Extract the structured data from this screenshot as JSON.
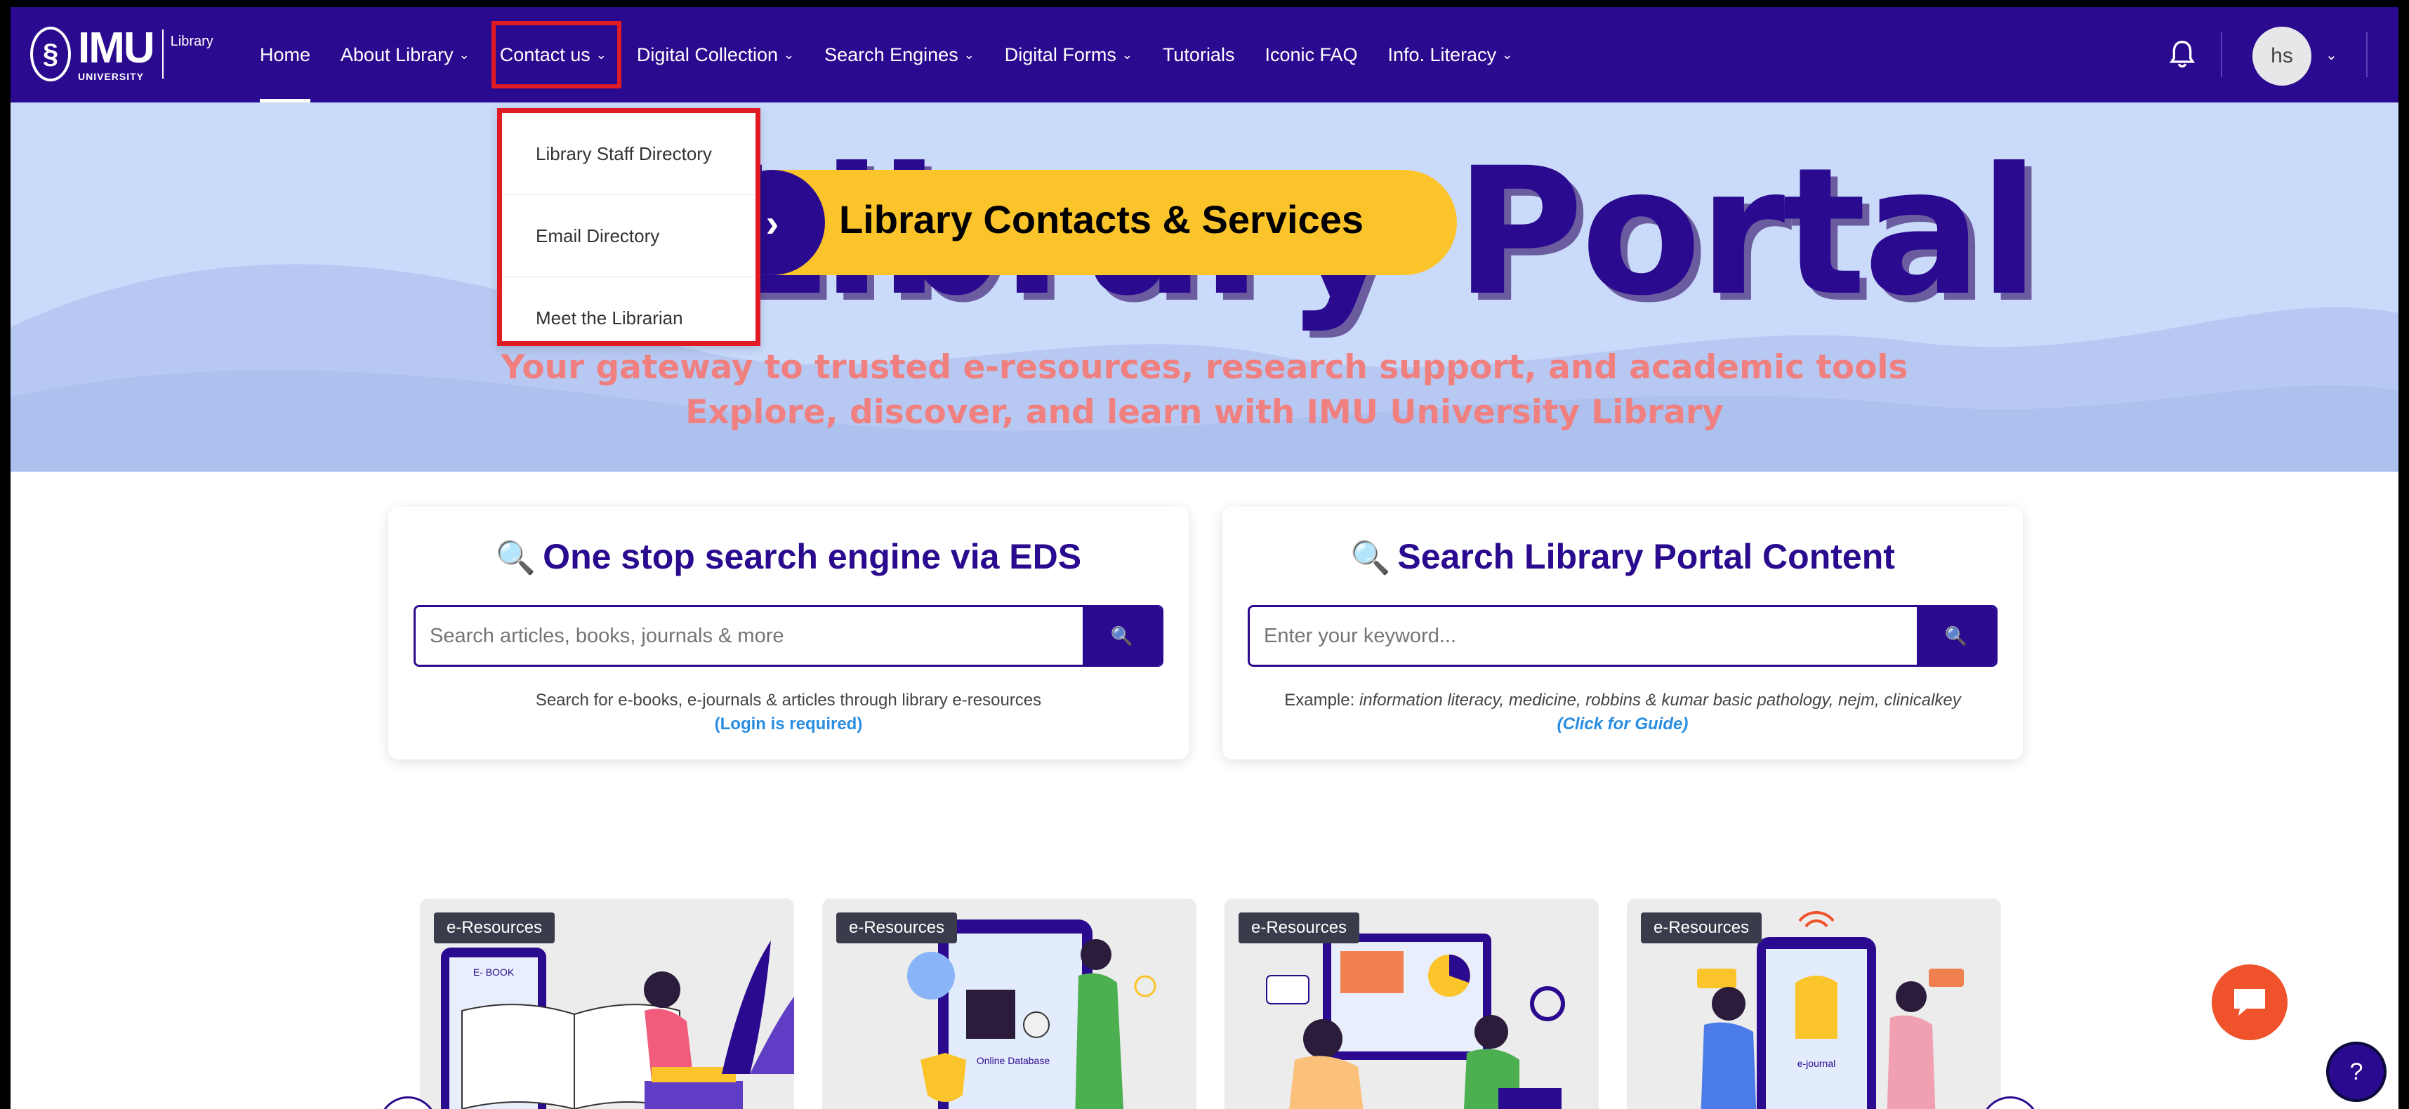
{
  "brand": {
    "logo_text": "IMU",
    "logo_sub": "UNIVERSITY",
    "logo_library": "Library"
  },
  "nav": {
    "items": [
      {
        "label": "Home",
        "has_dropdown": false
      },
      {
        "label": "About Library",
        "has_dropdown": true
      },
      {
        "label": "Contact us",
        "has_dropdown": true
      },
      {
        "label": "Digital Collection",
        "has_dropdown": true
      },
      {
        "label": "Search Engines",
        "has_dropdown": true
      },
      {
        "label": "Digital Forms",
        "has_dropdown": true
      },
      {
        "label": "Tutorials",
        "has_dropdown": false
      },
      {
        "label": "Iconic FAQ",
        "has_dropdown": false
      },
      {
        "label": "Info. Literacy",
        "has_dropdown": true
      }
    ],
    "user_initials": "hs"
  },
  "contact_dropdown": {
    "items": [
      "Library Staff Directory",
      "Email Directory",
      "Meet the Librarian"
    ]
  },
  "hero": {
    "title": "Library Portal",
    "subtitle_1": "Your gateway to trusted e-resources, research support, and academic tools",
    "subtitle_2": "Explore, discover, and learn with IMU University Library"
  },
  "callout": {
    "label": "Library Contacts & Services"
  },
  "eds_search": {
    "title": "One stop search engine via EDS",
    "placeholder": "Search articles, books, journals & more",
    "note": "Search for e-books, e-journals & articles through library e-resources",
    "link": "(Login is required)"
  },
  "portal_search": {
    "title": "Search Library Portal Content",
    "placeholder": "Enter your keyword...",
    "note_prefix": "Example: ",
    "note_examples": "information literacy, medicine, robbins & kumar basic pathology, nejm, clinicalkey",
    "link": "(Click for Guide)"
  },
  "resources": [
    {
      "badge": "e-Resources",
      "image_text": "E- BOOK"
    },
    {
      "badge": "e-Resources",
      "image_text": "Online Database"
    },
    {
      "badge": "e-Resources",
      "image_text": ""
    },
    {
      "badge": "e-Resources",
      "image_text": "e-journal"
    }
  ],
  "colors": {
    "brand": "#2a0a8e",
    "accent": "#fbc42b",
    "highlight": "#e01b24",
    "hero_bg": "#c9dafa",
    "subtitle": "#f08080",
    "chat": "#f0532b"
  },
  "icons": {
    "bell": "bell-icon",
    "search": "magnifier-icon",
    "chat": "chat-icon",
    "help": "help-icon"
  }
}
